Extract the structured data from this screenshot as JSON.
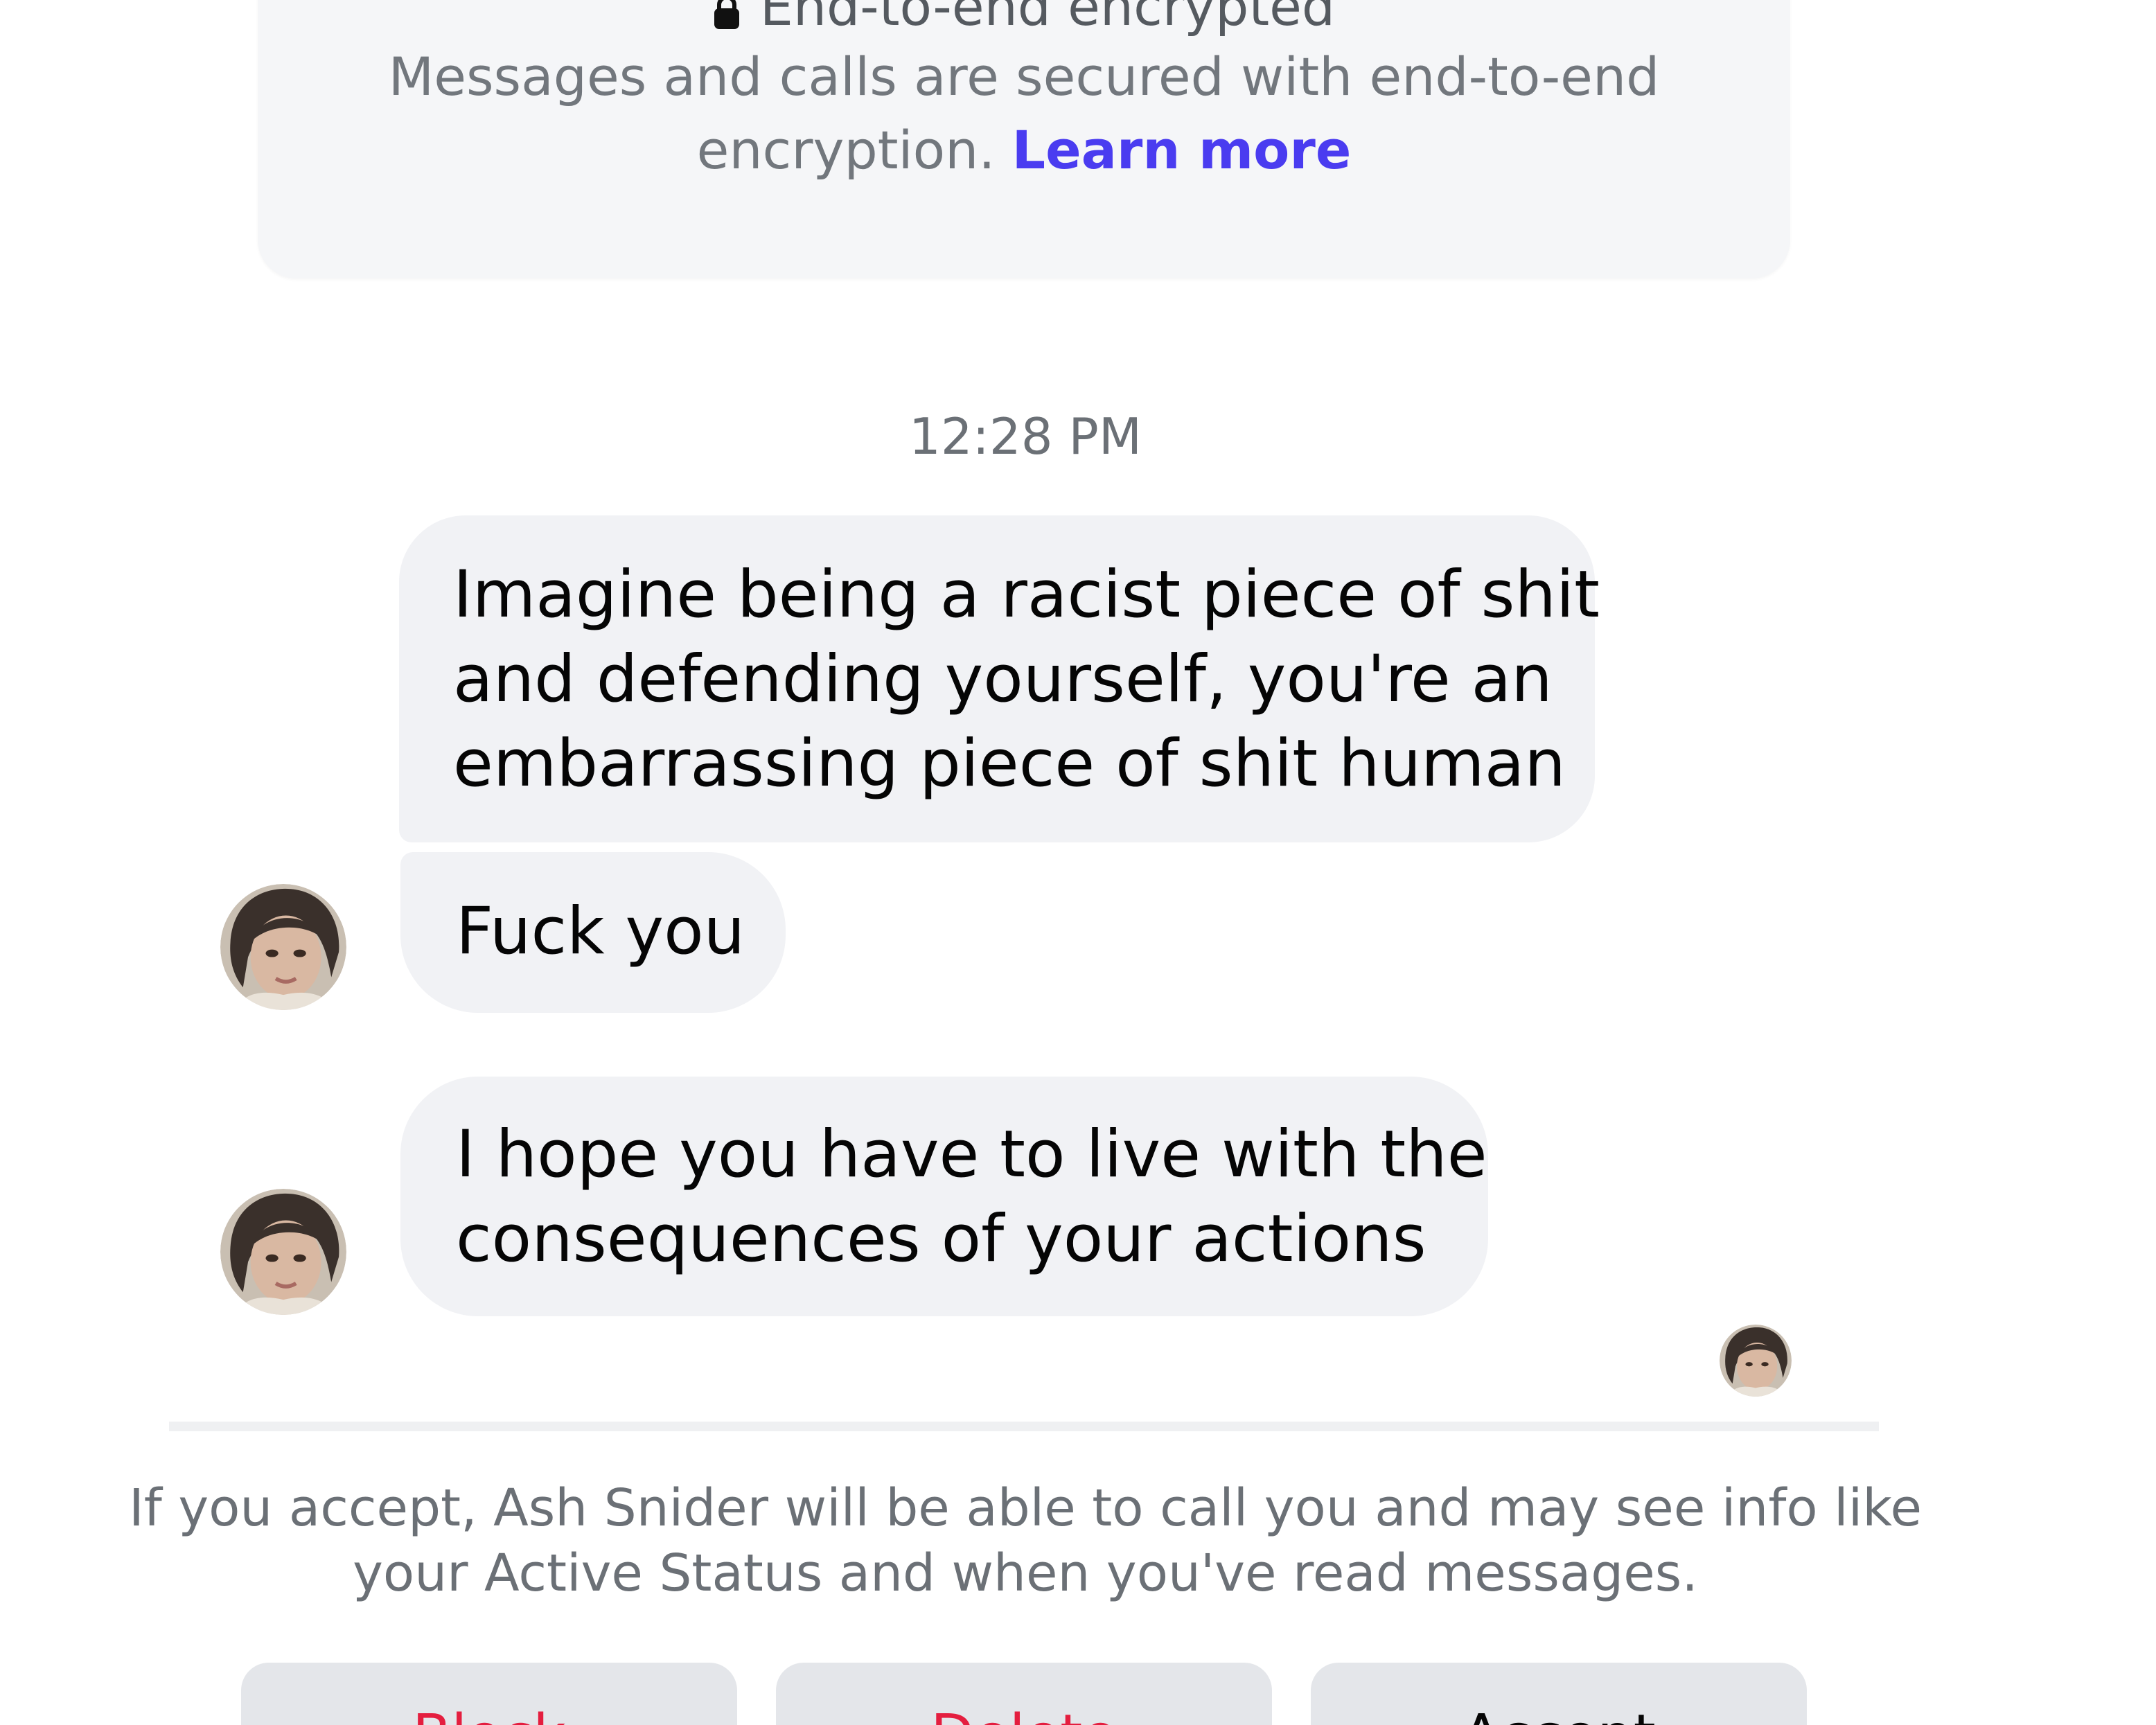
{
  "encryption_notice": {
    "title": "End-to-end encrypted",
    "body_line1": "Messages and calls are secured with end-to-end",
    "body_line2": "encryption.",
    "learn_more": "Learn more",
    "icon": "lock-icon"
  },
  "timestamp": "12:28 PM",
  "messages": [
    {
      "sender": "Ash Snider",
      "lines": [
        "Imagine being a racist piece of shit",
        "and defending yourself, you're an",
        "embarrassing piece of shit human"
      ]
    },
    {
      "sender": "Ash Snider",
      "lines": [
        "Fuck you"
      ]
    },
    {
      "sender": "Ash Snider",
      "lines": [
        "I hope you have to live with the",
        "consequences of your actions"
      ]
    }
  ],
  "request_notice": {
    "line1": "If you accept, Ash Snider will be able to call you and may see info like",
    "line2": "your Active Status and when you've read messages."
  },
  "actions": {
    "block": "Block",
    "delete": "Delete",
    "accept": "Accept"
  },
  "colors": {
    "link": "#4a3cf0",
    "destructive": "#e41e3f",
    "bubble": "#f1f2f5",
    "card": "#f5f6f8",
    "button": "#e4e6ea"
  }
}
